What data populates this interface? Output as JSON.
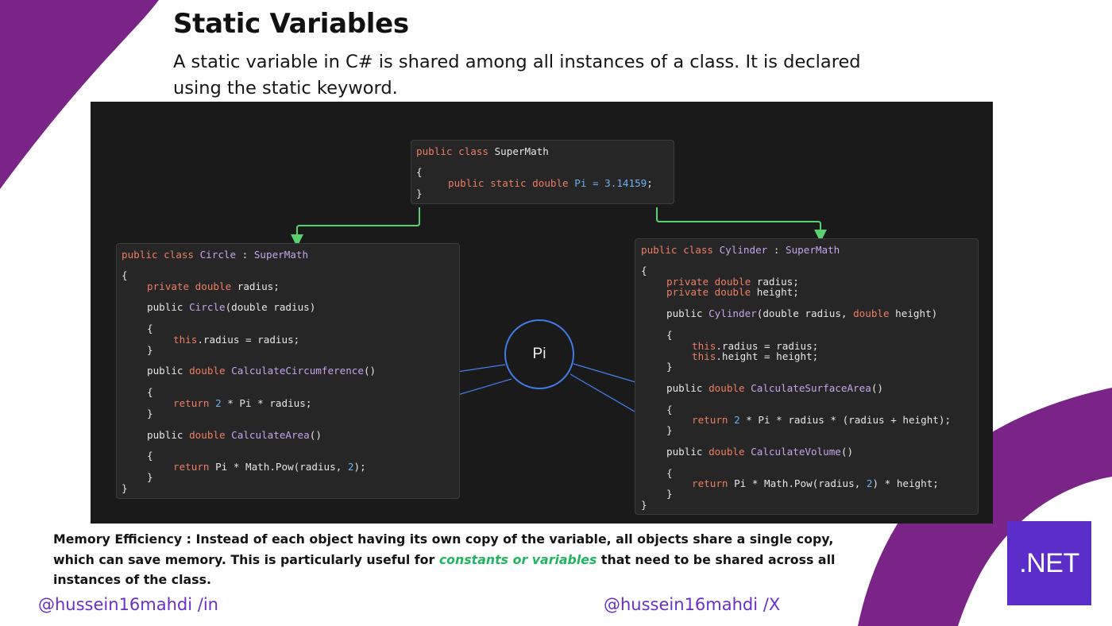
{
  "colors": {
    "accent_purple": "#7a2487",
    "canvas_bg": "#1a1a1a",
    "code_box_bg": "#262626",
    "keyword": "#ee7e63",
    "type_name": "#c6a4ee",
    "identifier": "#6cb0f2",
    "connector_green": "#5bd06e",
    "connector_blue": "#3f7ee8",
    "highlight_green": "#22b55f",
    "net_badge": "#5c2ec9",
    "handle_text": "#6a2fc9"
  },
  "header": {
    "title": "Static Variables",
    "subtitle": "A static variable in C# is shared among all instances of a class. It is declared using the static keyword."
  },
  "diagram": {
    "pi_node_label": "Pi",
    "supermath": {
      "line1": {
        "kw": "public class ",
        "name": "SuperMath"
      },
      "line2": "{",
      "line3": {
        "kw": "public static double ",
        "id": "Pi",
        "op": " = ",
        "num": "3.14159",
        "end": ";"
      },
      "line4": "}"
    },
    "circle": {
      "l1": {
        "kw": "public class ",
        "name": "Circle",
        "sep": " : ",
        "base": "SuperMath"
      },
      "l2": "{",
      "l3": {
        "kw": "private double ",
        "rest": "radius;"
      },
      "l4": {
        "a": "public ",
        "fn": "Circle",
        "b": "(double radius)"
      },
      "l5": "{",
      "l6": {
        "kw": "this",
        "rest": ".radius = radius;"
      },
      "l7": "}",
      "l8": {
        "a": "public ",
        "kw": "double ",
        "fn": "CalculateCircumference",
        "b": "()"
      },
      "l9": "{",
      "l10": {
        "kw": "return ",
        "num": "2",
        "rest": " * Pi * radius;"
      },
      "l11": "}",
      "l12": {
        "a": "public ",
        "kw": "double ",
        "fn": "CalculateArea",
        "b": "()"
      },
      "l13": "{",
      "l14": {
        "kw": "return ",
        "pre": "Pi * Math.Pow(radius, ",
        "num": "2",
        "post": ");"
      },
      "l15": "}",
      "l16": "}"
    },
    "cylinder": {
      "l1": {
        "kw": "public class ",
        "name": "Cylinder",
        "sep": " : ",
        "base": "SuperMath"
      },
      "l2": "{",
      "l3": {
        "kw": "private double ",
        "rest": "radius;"
      },
      "l4": {
        "kw": "private double ",
        "rest": "height;"
      },
      "l5": {
        "a": "public ",
        "fn": "Cylinder",
        "b": "(double radius, ",
        "kw": "double ",
        "c": "height)"
      },
      "l6": "{",
      "l7": {
        "kw": "this",
        "rest": ".radius = radius;"
      },
      "l8": {
        "kw": "this",
        "rest": ".height = height;"
      },
      "l9": "}",
      "l10": {
        "a": "public ",
        "kw": "double ",
        "fn": "CalculateSurfaceArea",
        "b": "()"
      },
      "l11": "{",
      "l12": {
        "kw": "return ",
        "num": "2",
        "rest": " * Pi * radius * (radius + height);"
      },
      "l13": "}",
      "l14": {
        "a": "public ",
        "kw": "double ",
        "fn": "CalculateVolume",
        "b": "()"
      },
      "l15": "{",
      "l16": {
        "kw": "return ",
        "pre": "Pi * Math.Pow(radius, ",
        "num": "2",
        "post": ") * height;"
      },
      "l17": "}",
      "l18": "}"
    }
  },
  "note": {
    "part1": "Memory Efficiency : Instead of each object having its own copy of the variable, all objects share a single copy, which can save memory. This is particularly useful for ",
    "highlight": "constants or variables",
    "part2": " that need to be shared across all instances of the class."
  },
  "footer": {
    "handle_in": "@hussein16mahdi /in",
    "handle_x": "@hussein16mahdi /X"
  },
  "badge": {
    "label": ".NET"
  }
}
